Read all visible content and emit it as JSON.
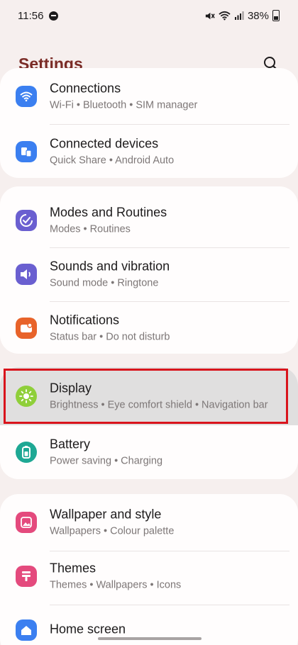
{
  "status_bar": {
    "time": "11:56",
    "battery": "38%"
  },
  "header": {
    "title": "Settings",
    "search_icon": "search-icon"
  },
  "colors": {
    "title": "#7a2b26",
    "connections": "#3b7ff0",
    "connected_devices": "#3b7ff0",
    "modes": "#6a5fd0",
    "sounds": "#6a5fd0",
    "notifications": "#e8632a",
    "display": "#8fcf3a",
    "battery": "#1ea894",
    "wallpaper": "#e44a7d",
    "themes": "#e44a7d",
    "home": "#3b7ff0",
    "highlight": "#d9141c"
  },
  "groups": [
    {
      "items": [
        {
          "title": "Connections",
          "subtitle": "Wi-Fi  •  Bluetooth  •  SIM manager",
          "icon": "wifi-icon"
        },
        {
          "title": "Connected devices",
          "subtitle": "Quick Share  •  Android Auto",
          "icon": "devices-icon"
        }
      ]
    },
    {
      "items": [
        {
          "title": "Modes and Routines",
          "subtitle": "Modes  •  Routines",
          "icon": "check-circle-icon"
        },
        {
          "title": "Sounds and vibration",
          "subtitle": "Sound mode  •  Ringtone",
          "icon": "speaker-icon"
        },
        {
          "title": "Notifications",
          "subtitle": "Status bar  •  Do not disturb",
          "icon": "notification-icon"
        }
      ]
    },
    {
      "items": [
        {
          "title": "Display",
          "subtitle": "Brightness  •  Eye comfort shield  •  Navigation bar",
          "icon": "brightness-icon",
          "highlighted": true
        },
        {
          "title": "Battery",
          "subtitle": "Power saving  •  Charging",
          "icon": "battery-icon"
        }
      ]
    },
    {
      "items": [
        {
          "title": "Wallpaper and style",
          "subtitle": "Wallpapers  •  Colour palette",
          "icon": "wallpaper-icon"
        },
        {
          "title": "Themes",
          "subtitle": "Themes  •  Wallpapers  •  Icons",
          "icon": "themes-icon"
        },
        {
          "title": "Home screen",
          "subtitle": "",
          "icon": "home-icon"
        }
      ]
    }
  ]
}
